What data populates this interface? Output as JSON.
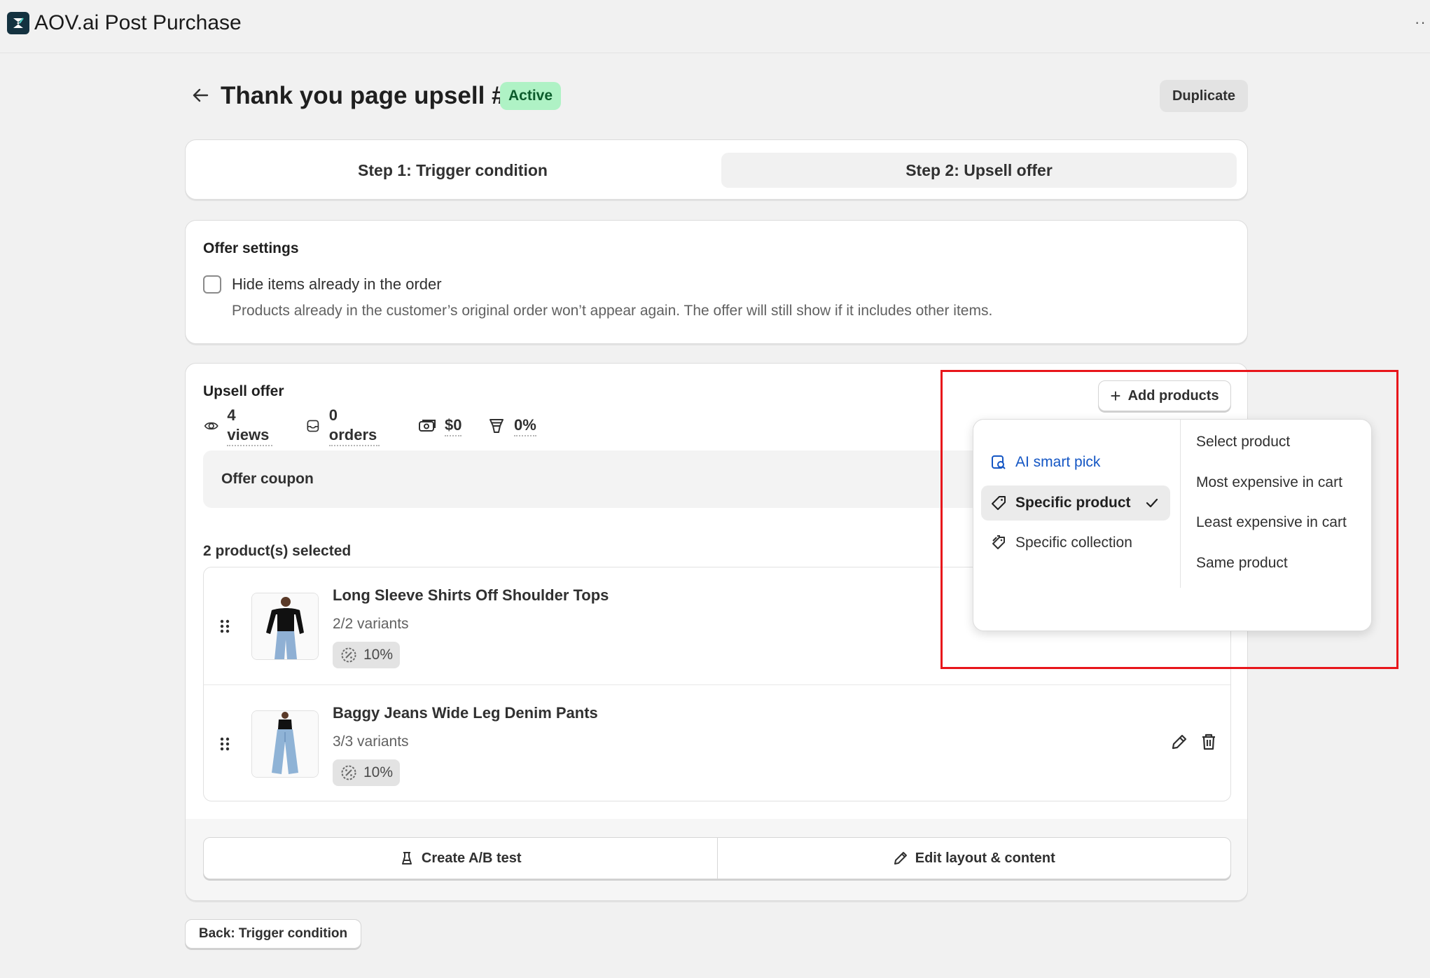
{
  "app": {
    "title": "AOV.ai Post Purchase",
    "more": "··"
  },
  "header": {
    "title": "Thank you page upsell #1",
    "status": "Active",
    "duplicate_label": "Duplicate"
  },
  "steps": {
    "step1": "Step 1: Trigger condition",
    "step2": "Step 2: Upsell offer",
    "active": 2
  },
  "offer_settings": {
    "title": "Offer settings",
    "checkbox_label": "Hide items already in the order",
    "checked": false,
    "help": "Products already in the customer’s original order won’t appear again. The offer will still show if it includes other items."
  },
  "upsell": {
    "title": "Upsell offer",
    "add_products": "Add products",
    "metrics": {
      "views": "4 views",
      "orders": "0 orders",
      "revenue": "$0",
      "conversion": "0%"
    },
    "coupon_label": "Offer coupon",
    "selected_count": "2 product(s) selected",
    "products": [
      {
        "name": "Long Sleeve Shirts Off Shoulder Tops",
        "variants": "2/2 variants",
        "discount": "10%",
        "image": "black-off-shoulder-top"
      },
      {
        "name": "Baggy Jeans Wide Leg Denim Pants",
        "variants": "3/3 variants",
        "discount": "10%",
        "image": "baggy-jeans"
      }
    ],
    "footer": {
      "ab_test": "Create A/B test",
      "edit_layout": "Edit layout & content"
    }
  },
  "add_products_menu": {
    "left": {
      "ai": "AI smart pick",
      "specific": "Specific product",
      "collection": "Specific collection",
      "selected": "Specific product"
    },
    "right": [
      "Select product",
      "Most expensive in cart",
      "Least expensive in cart",
      "Same product"
    ]
  },
  "back_button": "Back: Trigger condition",
  "colors": {
    "badge_bg": "#aff2c5",
    "ai_blue": "#1456c4",
    "highlight": "#e8161b"
  }
}
